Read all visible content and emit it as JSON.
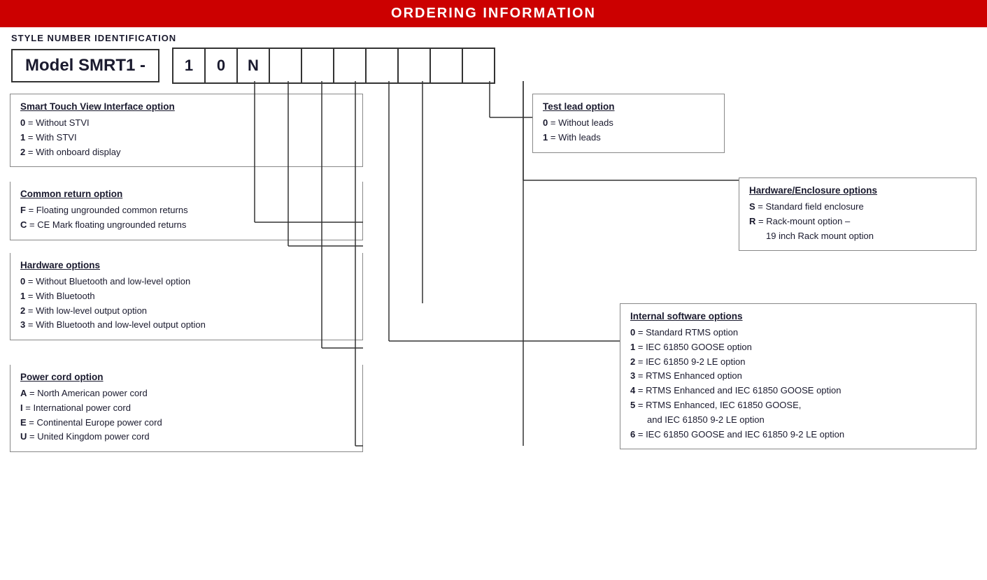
{
  "header": {
    "title": "ORDERING INFORMATION"
  },
  "style_number": {
    "label": "STYLE NUMBER IDENTIFICATION"
  },
  "model": {
    "prefix": "Model SMRT1 -",
    "digits": [
      "1",
      "0",
      "N",
      "",
      "",
      "",
      "",
      "",
      "",
      ""
    ]
  },
  "smart_touch_view": {
    "title": "Smart Touch View Interface option",
    "items": [
      {
        "key": "0",
        "desc": "= Without STVI"
      },
      {
        "key": "1",
        "desc": "= With STVI"
      },
      {
        "key": "2",
        "desc": "= With onboard display"
      }
    ]
  },
  "common_return": {
    "title": "Common return option",
    "items": [
      {
        "key": "F",
        "desc": "= Floating ungrounded common returns"
      },
      {
        "key": "C",
        "desc": "= CE Mark floating ungrounded returns"
      }
    ]
  },
  "hardware_options": {
    "title": "Hardware options",
    "items": [
      {
        "key": "0",
        "desc": "= Without Bluetooth and low-level option"
      },
      {
        "key": "1",
        "desc": "= With Bluetooth"
      },
      {
        "key": "2",
        "desc": "= With low-level output option"
      },
      {
        "key": "3",
        "desc": "= With Bluetooth and low-level output option"
      }
    ]
  },
  "power_cord": {
    "title": "Power cord option",
    "items": [
      {
        "key": "A",
        "desc": "= North American power cord"
      },
      {
        "key": "I",
        "desc": "= International power cord"
      },
      {
        "key": "E",
        "desc": "= Continental Europe power cord"
      },
      {
        "key": "U",
        "desc": "= United Kingdom power cord"
      }
    ]
  },
  "test_lead": {
    "title": "Test lead option",
    "items": [
      {
        "key": "0",
        "desc": "= Without leads"
      },
      {
        "key": "1",
        "desc": "= With leads"
      }
    ]
  },
  "hw_enclosure": {
    "title": "Hardware/Enclosure options",
    "items": [
      {
        "key": "S",
        "desc": "= Standard field enclosure"
      },
      {
        "key": "R",
        "desc": "= Rack-mount option – 19 inch Rack mount option"
      }
    ]
  },
  "internal_software": {
    "title": "Internal software options",
    "items": [
      {
        "key": "0",
        "desc": "= Standard RTMS option"
      },
      {
        "key": "1",
        "desc": "= IEC 61850 GOOSE option"
      },
      {
        "key": "2",
        "desc": "= IEC 61850 9-2 LE option"
      },
      {
        "key": "3",
        "desc": "= RTMS Enhanced option"
      },
      {
        "key": "4",
        "desc": "= RTMS Enhanced and IEC 61850 GOOSE option"
      },
      {
        "key": "5",
        "desc": "= RTMS Enhanced, IEC 61850 GOOSE, and IEC 61850 9-2 LE option"
      },
      {
        "key": "6",
        "desc": "= IEC 61850 GOOSE and IEC 61850 9-2 LE option"
      }
    ]
  },
  "colors": {
    "header_bg": "#cc0000",
    "header_text": "#ffffff",
    "border": "#888888",
    "text_main": "#1a1a2e",
    "key_color": "#1a1a2e"
  }
}
